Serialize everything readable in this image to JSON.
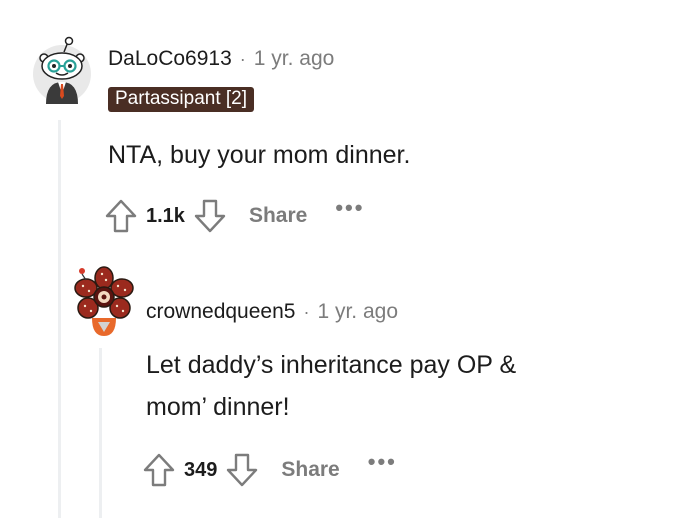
{
  "comments": [
    {
      "author": "DaLoCo6913",
      "separator": "·",
      "time": "1 yr. ago",
      "flair": "Partassipant [2]",
      "body": "NTA, buy your mom dinner.",
      "score": "1.1k",
      "share_label": "Share",
      "more_label": "•••",
      "avatar_icon": "snoo-avatar-icon"
    },
    {
      "author": "crownedqueen5",
      "separator": "·",
      "time": "1 yr. ago",
      "body_line1": "Let daddy’s inheritance pay OP &",
      "body_line2": "mom’ dinner!",
      "score": "349",
      "share_label": "Share",
      "more_label": "•••",
      "avatar_icon": "demogorgon-avatar-icon"
    }
  ],
  "colors": {
    "flair_bg": "#4a2e24",
    "meta_gray": "#7c7c7c",
    "thread_line": "#edeff1"
  }
}
